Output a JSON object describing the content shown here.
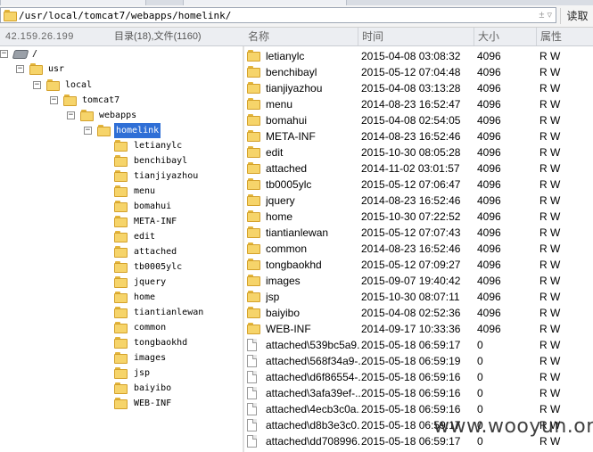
{
  "path": {
    "value": "/usr/local/tomcat7/webapps/homelink/",
    "control": "± ▿"
  },
  "read_button": "读取",
  "info": {
    "ip": "42.159.26.199",
    "counts": "目录(18),文件(1160)"
  },
  "columns": {
    "name": "名称",
    "time": "时间",
    "size": "大小",
    "attr": "属性"
  },
  "tree": {
    "root": "/",
    "usr": "usr",
    "local": "local",
    "tomcat7": "tomcat7",
    "webapps": "webapps",
    "homelink": "homelink",
    "children": [
      "letianylc",
      "benchibayl",
      "tianjiyazhou",
      "menu",
      "bomahui",
      "META-INF",
      "edit",
      "attached",
      "tb0005ylc",
      "jquery",
      "home",
      "tiantianlewan",
      "common",
      "tongbaokhd",
      "images",
      "jsp",
      "baiyibo",
      "WEB-INF"
    ]
  },
  "files": [
    {
      "type": "folder",
      "name": "letianylc",
      "time": "2015-04-08 03:08:32",
      "size": "4096",
      "attr": "R W"
    },
    {
      "type": "folder",
      "name": "benchibayl",
      "time": "2015-05-12 07:04:48",
      "size": "4096",
      "attr": "R W"
    },
    {
      "type": "folder",
      "name": "tianjiyazhou",
      "time": "2015-04-08 03:13:28",
      "size": "4096",
      "attr": "R W"
    },
    {
      "type": "folder",
      "name": "menu",
      "time": "2014-08-23 16:52:47",
      "size": "4096",
      "attr": "R W"
    },
    {
      "type": "folder",
      "name": "bomahui",
      "time": "2015-04-08 02:54:05",
      "size": "4096",
      "attr": "R W"
    },
    {
      "type": "folder",
      "name": "META-INF",
      "time": "2014-08-23 16:52:46",
      "size": "4096",
      "attr": "R W"
    },
    {
      "type": "folder",
      "name": "edit",
      "time": "2015-10-30 08:05:28",
      "size": "4096",
      "attr": "R W"
    },
    {
      "type": "folder",
      "name": "attached",
      "time": "2014-11-02 03:01:57",
      "size": "4096",
      "attr": "R W"
    },
    {
      "type": "folder",
      "name": "tb0005ylc",
      "time": "2015-05-12 07:06:47",
      "size": "4096",
      "attr": "R W"
    },
    {
      "type": "folder",
      "name": "jquery",
      "time": "2014-08-23 16:52:46",
      "size": "4096",
      "attr": "R W"
    },
    {
      "type": "folder",
      "name": "home",
      "time": "2015-10-30 07:22:52",
      "size": "4096",
      "attr": "R W"
    },
    {
      "type": "folder",
      "name": "tiantianlewan",
      "time": "2015-05-12 07:07:43",
      "size": "4096",
      "attr": "R W"
    },
    {
      "type": "folder",
      "name": "common",
      "time": "2014-08-23 16:52:46",
      "size": "4096",
      "attr": "R W"
    },
    {
      "type": "folder",
      "name": "tongbaokhd",
      "time": "2015-05-12 07:09:27",
      "size": "4096",
      "attr": "R W"
    },
    {
      "type": "folder",
      "name": "images",
      "time": "2015-09-07 19:40:42",
      "size": "4096",
      "attr": "R W"
    },
    {
      "type": "folder",
      "name": "jsp",
      "time": "2015-10-30 08:07:11",
      "size": "4096",
      "attr": "R W"
    },
    {
      "type": "folder",
      "name": "baiyibo",
      "time": "2015-04-08 02:52:36",
      "size": "4096",
      "attr": "R W"
    },
    {
      "type": "folder",
      "name": "WEB-INF",
      "time": "2014-09-17 10:33:36",
      "size": "4096",
      "attr": "R W"
    },
    {
      "type": "file",
      "name": "attached\\539bc5a9...",
      "time": "2015-05-18 06:59:17",
      "size": "0",
      "attr": "R W"
    },
    {
      "type": "file",
      "name": "attached\\568f34a9-...",
      "time": "2015-05-18 06:59:19",
      "size": "0",
      "attr": "R W"
    },
    {
      "type": "file",
      "name": "attached\\d6f86554-...",
      "time": "2015-05-18 06:59:16",
      "size": "0",
      "attr": "R W"
    },
    {
      "type": "file",
      "name": "attached\\3afa39ef-...",
      "time": "2015-05-18 06:59:16",
      "size": "0",
      "attr": "R W"
    },
    {
      "type": "file",
      "name": "attached\\4ecb3c0a...",
      "time": "2015-05-18 06:59:16",
      "size": "0",
      "attr": "R W"
    },
    {
      "type": "file",
      "name": "attached\\d8b3e3c0...",
      "time": "2015-05-18 06:59:17",
      "size": "0",
      "attr": "R W"
    },
    {
      "type": "file",
      "name": "attached\\dd708996...",
      "time": "2015-05-18 06:59:17",
      "size": "0",
      "attr": "R W"
    }
  ],
  "watermark": "www.wooyun.org"
}
